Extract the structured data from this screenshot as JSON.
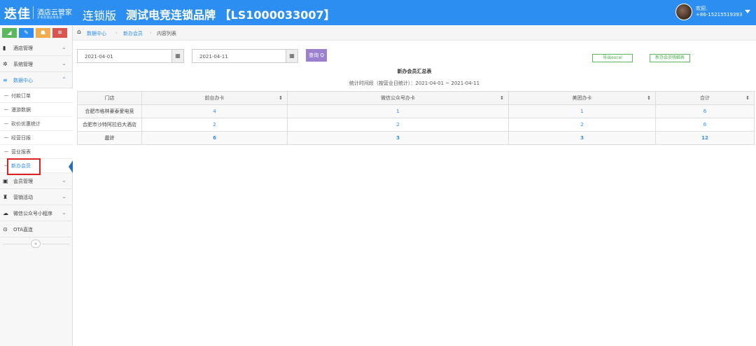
{
  "header": {
    "logo": "迭佳",
    "logo_sub1": "酒店云管家",
    "logo_sub2": "开电竞酒店用迭佳",
    "edition": "连锁版",
    "brand": "测试电竞连锁品牌 【LS1000033007】",
    "welcome": "欢迎,",
    "phone": "+86-15215519393"
  },
  "sidebar": {
    "shortcuts": [
      {
        "icon": "chart-icon",
        "symbol": "◢",
        "color": "#5cb85c"
      },
      {
        "icon": "pencil-icon",
        "symbol": "✎",
        "color": "#2b8ef0"
      },
      {
        "icon": "users-icon",
        "symbol": "☗",
        "color": "#f0ad4e"
      },
      {
        "icon": "cogs-icon",
        "symbol": "✲",
        "color": "#d9534f"
      }
    ],
    "menu": [
      {
        "label": "酒店管理",
        "icon": "hotel-icon",
        "symbol": "▮"
      },
      {
        "label": "系统管理",
        "icon": "gear-icon",
        "symbol": "✲"
      },
      {
        "label": "数据中心",
        "icon": "database-icon",
        "symbol": "≡"
      }
    ],
    "sub_items": [
      "付款订单",
      "漫游数据",
      "砍价优惠统计",
      "经营日报",
      "营业报表",
      "新办会员"
    ],
    "menu_after": [
      {
        "label": "会员管理",
        "icon": "member-card-icon",
        "symbol": "▣"
      },
      {
        "label": "营销活动",
        "icon": "gift-icon",
        "symbol": "♜"
      },
      {
        "label": "微信公众号小程序",
        "icon": "cloud-icon",
        "symbol": "☁"
      },
      {
        "label": "OTA直连",
        "icon": "handshake-icon",
        "symbol": "⊙"
      }
    ],
    "collapse": "«"
  },
  "breadcrumb": {
    "items": [
      "数据中心",
      "新办会员",
      "内容列表"
    ],
    "sep": "›"
  },
  "filters": {
    "start_date": "2021-04-01",
    "end_date": "2021-04-11",
    "cal_symbol": "▦",
    "query_label": "查询 Q",
    "export_label": "导出excel",
    "detail_label": "新办会员明细表"
  },
  "report": {
    "title": "新办会员汇总表",
    "period": "统计时间段（按营业日统计）：2021-04-01 ~ 2021-04-11"
  },
  "table": {
    "columns": [
      "门店",
      "前台办卡",
      "微信公众号办卡",
      "美团办卡",
      "合计"
    ],
    "sort_symbol": "⇕",
    "rows": [
      [
        "合肥市格林豪泰爱电竞",
        "4",
        "1",
        "1",
        "6"
      ],
      [
        "合肥市沙特阿拉伯大酒店",
        "2",
        "2",
        "2",
        "6"
      ]
    ],
    "total": [
      "总计",
      "6",
      "3",
      "3",
      "12"
    ]
  }
}
